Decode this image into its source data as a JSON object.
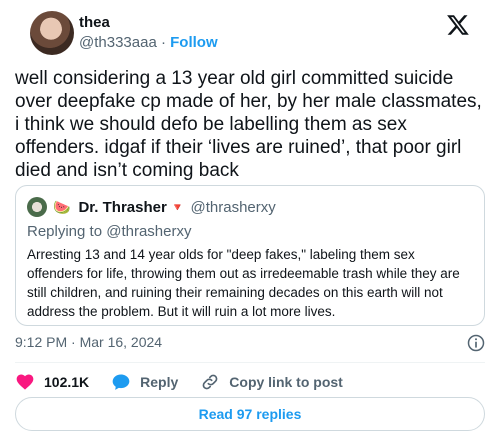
{
  "author": {
    "name": "thea",
    "handle": "@th333aaa",
    "separator": "·",
    "follow_label": "Follow"
  },
  "tweet": {
    "text": "well considering a 13 year old girl committed suicide over deepfake cp made of her, by her male classmates, i think we should defo be labelling them as sex offenders. idgaf if their ‘lives are ruined’, that poor girl died and isn’t coming back",
    "timestamp": "9:12 PM · Mar 16, 2024"
  },
  "quote": {
    "emoji": "🍉",
    "name": "Dr. Thrasher",
    "badge": "🔻",
    "handle": "@thrasherxy",
    "replying_to": "Replying to @thrasherxy",
    "text": "Arresting 13 and 14 year olds for \"deep fakes,\" labeling them sex offenders for life, throwing them out as irredeemable trash while they are still children, and ruining their remaining decades on this earth will not address the problem. But it will ruin a lot more lives."
  },
  "actions": {
    "like_count": "102.1K",
    "reply_label": "Reply",
    "copy_label": "Copy link to post"
  },
  "read_replies_label": "Read 97 replies",
  "icons": {
    "logo": "x-logo-icon",
    "info": "info-icon",
    "like": "heart-icon",
    "reply": "speech-bubble-icon",
    "copy": "link-icon"
  },
  "colors": {
    "accent": "#1d9bf0",
    "like": "#f91880",
    "text": "#0f1419",
    "muted": "#536471",
    "border": "#cfd9de"
  }
}
